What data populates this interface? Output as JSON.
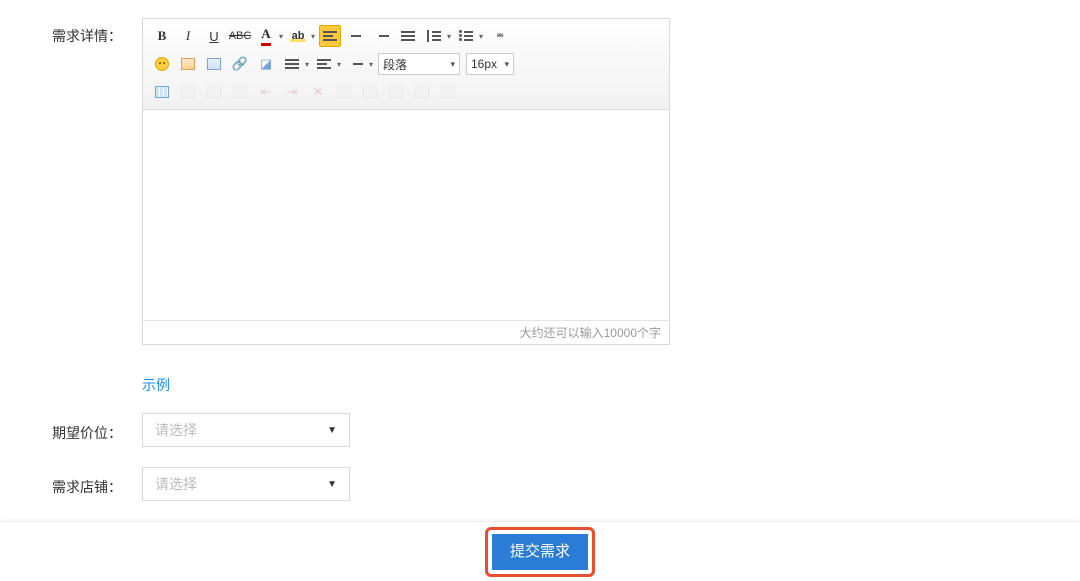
{
  "labels": {
    "detail": "需求详情：",
    "price": "期望价位：",
    "shop": "需求店铺："
  },
  "editor": {
    "format_select": "段落",
    "size_select": "16px",
    "counter": "大约还可以输入10000个字"
  },
  "example_link": "示例",
  "selects": {
    "price_placeholder": "请选择",
    "shop_placeholder": "请选择"
  },
  "submit_label": "提交需求",
  "toolbar_icons": {
    "bold": "B",
    "italic": "I",
    "underline": "U",
    "strike": "ABC",
    "forecolor": "A",
    "backcolor": "ab"
  }
}
